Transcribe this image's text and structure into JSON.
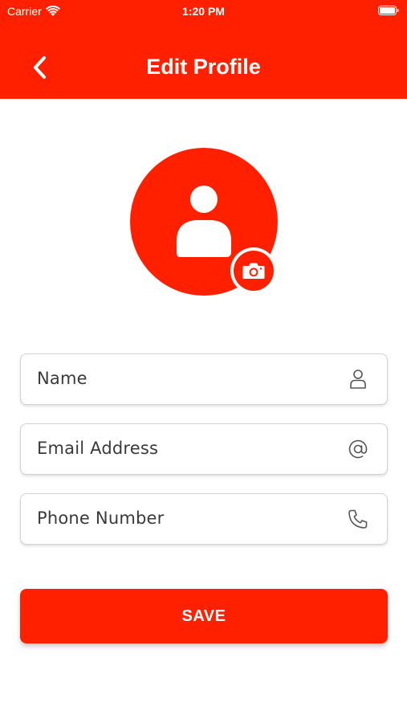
{
  "status_bar": {
    "carrier": "Carrier",
    "time": "1:20 PM",
    "wifi_icon": "wifi-icon",
    "battery_icon": "battery-icon"
  },
  "header": {
    "title": "Edit Profile",
    "back_icon": "chevron-left-icon",
    "background_color": "#ff2000"
  },
  "avatar": {
    "icon": "person-icon",
    "camera_icon": "camera-icon"
  },
  "form": {
    "fields": [
      {
        "placeholder": "Name",
        "icon": "user-icon"
      },
      {
        "placeholder": "Email Address",
        "icon": "at-icon"
      },
      {
        "placeholder": "Phone Number",
        "icon": "phone-icon"
      }
    ]
  },
  "save_button": {
    "label": "SAVE"
  },
  "colors": {
    "accent": "#ff2000",
    "field_border": "#d2d2d2",
    "text": "#3a3a3a"
  }
}
